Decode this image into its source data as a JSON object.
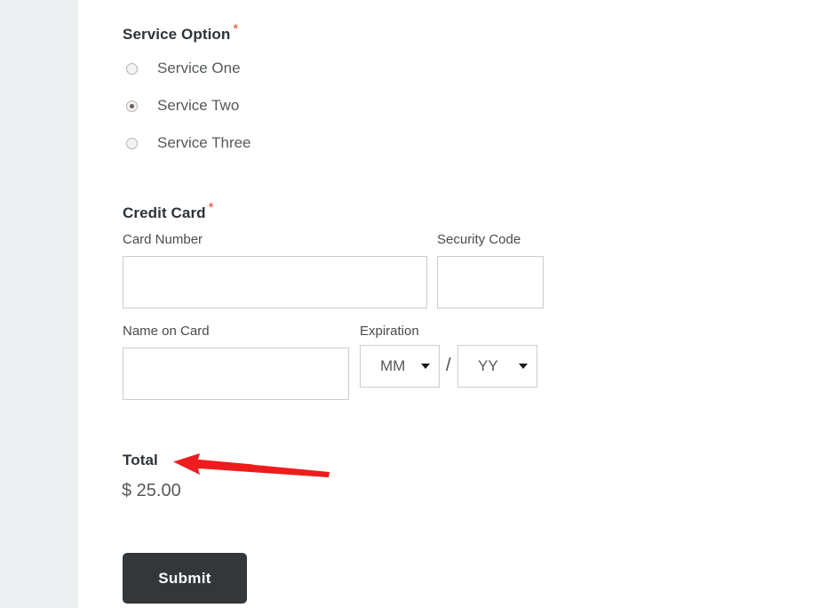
{
  "form": {
    "service_option": {
      "heading": "Service Option",
      "required_marker": "*",
      "options": [
        {
          "label": "Service One",
          "selected": false
        },
        {
          "label": "Service Two",
          "selected": true
        },
        {
          "label": "Service Three",
          "selected": false
        }
      ]
    },
    "credit_card": {
      "heading": "Credit Card",
      "required_marker": "*",
      "card_number": {
        "label": "Card Number",
        "value": "",
        "placeholder": ""
      },
      "security_code": {
        "label": "Security Code",
        "value": "",
        "placeholder": ""
      },
      "name_on_card": {
        "label": "Name on Card",
        "value": "",
        "placeholder": ""
      },
      "expiration": {
        "label": "Expiration",
        "separator": "/",
        "month": {
          "value": "MM",
          "arrow_icon": "chevron-down-icon"
        },
        "year": {
          "value": "YY",
          "arrow_icon": "chevron-down-icon"
        }
      }
    },
    "total": {
      "label": "Total",
      "amount": "$ 25.00"
    },
    "submit": {
      "label": "Submit"
    }
  },
  "annotation": {
    "arrow": {
      "icon": "arrow-left-annotation",
      "color": "#ee1c1c",
      "points_to": "Total"
    }
  },
  "colors": {
    "sidebar_background": "#ecf0f1",
    "content_background": "#ffffff",
    "heading_text": "#2d3338",
    "label_text": "#4a4a4a",
    "body_text": "#55595c",
    "required_marker": "#e8402a",
    "input_border": "#cccccc",
    "submit_background": "#33373a",
    "submit_text": "#ffffff",
    "annotation_arrow": "#ee1c1c"
  }
}
